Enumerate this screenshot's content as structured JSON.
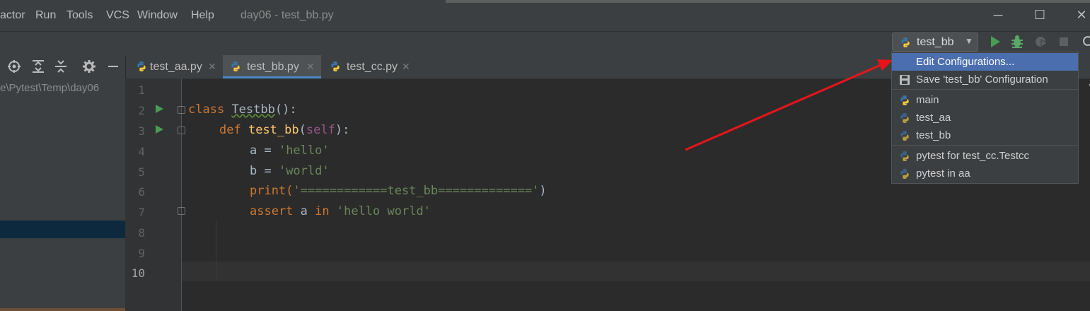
{
  "menu": {
    "items": [
      "actor",
      "Run",
      "Tools",
      "VCS",
      "Window",
      "Help"
    ],
    "window_title": "day06 - test_bb.py"
  },
  "window_controls": {
    "minimize": "─",
    "maximize": "☐",
    "close": "✕"
  },
  "toolbar": {
    "run_config": "test_bb",
    "icons": [
      "run-icon",
      "debug-icon",
      "coverage-icon",
      "stop-icon",
      "search-icon"
    ]
  },
  "project": {
    "path": "e\\Pytest\\Temp\\day06",
    "header_icons": [
      "target-icon",
      "expand-all-icon",
      "collapse-all-icon",
      "gear-icon",
      "minimize-icon"
    ]
  },
  "tabs": [
    {
      "label": "test_aa.py",
      "close": "✕"
    },
    {
      "label": "test_bb.py",
      "close": "✕",
      "active": true
    },
    {
      "label": "test_cc.py",
      "close": "✕"
    }
  ],
  "editor": {
    "line_numbers": [
      "1",
      "2",
      "3",
      "4",
      "5",
      "6",
      "7",
      "8",
      "9",
      "10"
    ],
    "current_line": "10",
    "lines": {
      "l2": {
        "kw": "class",
        "name": "Testbb",
        "rest": "():"
      },
      "l3": {
        "kw": "def",
        "name": "test_bb",
        "open": "(",
        "self": "self",
        "close": "):"
      },
      "l4": {
        "var": "a = ",
        "str": "'hello'"
      },
      "l5": {
        "var": "b = ",
        "str": "'world'"
      },
      "l6": {
        "fn": "print(",
        "str": "'============test_bb============='",
        "close": ")"
      },
      "l7": {
        "kw": "assert",
        "mid": " a ",
        "kw2": "in",
        "str": " 'hello world'"
      }
    }
  },
  "dropdown": {
    "items": [
      {
        "label": "Edit Configurations...",
        "selected": true
      },
      {
        "label": "Save 'test_bb' Configuration"
      },
      {
        "label": "main"
      },
      {
        "label": "test_aa"
      },
      {
        "label": "test_bb"
      },
      {
        "label": "pytest for test_cc.Testcc"
      },
      {
        "label": "pytest in aa"
      }
    ]
  },
  "colors": {
    "background": "#2b2b2b",
    "panel": "#3c3f41",
    "selection": "#4b6eaf",
    "keyword": "#cc7832",
    "string": "#6a8759",
    "function": "#ffc66d",
    "annotation_arrow": "#e8141a",
    "run_green": "#499c54"
  }
}
